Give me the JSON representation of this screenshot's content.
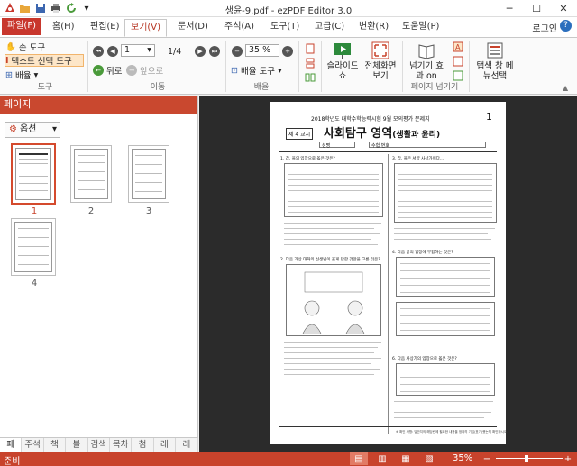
{
  "window": {
    "title": "생윤-9.pdf - ezPDF Editor 3.0"
  },
  "menu": {
    "tabs": [
      "파일(F)",
      "홈(H)",
      "편집(E)",
      "보기(V)",
      "문서(D)",
      "주석(A)",
      "도구(T)",
      "고급(C)",
      "변환(R)",
      "도움말(P)"
    ],
    "login": "로그인"
  },
  "ribbon": {
    "tools": {
      "hand": "손 도구",
      "text_select": "텍스트 선택 도구",
      "zoom": "배율",
      "label": "도구"
    },
    "move": {
      "page": "1",
      "total": "1/4",
      "back": "뒤로",
      "forward": "앞으로",
      "label": "이동"
    },
    "zoom": {
      "value": "35 %",
      "dropdown": "배율 도구",
      "label": "배율"
    },
    "slideshow": "슬라이드쇼",
    "fullscreen": "전체화면 보기",
    "page_view": {
      "effect": "넘기기 효과 on",
      "label": "페이지 넘기기"
    },
    "tab_menu": "탭색 창 메뉴선택"
  },
  "left_panel": {
    "title": "페이지",
    "options": "옵션",
    "thumbs": [
      "1",
      "2",
      "3",
      "4"
    ],
    "bottom_tabs": [
      "페",
      "주석",
      "책",
      "블",
      "검색",
      "목차",
      "첨",
      "레",
      "레"
    ]
  },
  "document": {
    "header": "2018학년도 대학수학능력시험 9월 모의평가 문제지",
    "page_num": "1",
    "period": "제 4 교시",
    "subject": "사회탐구 영역",
    "subject_sub": "(생활과 윤리)",
    "name_label": "성명",
    "exam_no_label": "수험 번호",
    "q1": "1. 갑, 을의 입장으로 옳은 것은?",
    "q2": "2. 다음 가상 대화의 선생님이 옳게 답한 것만을 고른 것은?",
    "q3": "3. 갑, 을은 서양 사상가이다...",
    "q4": "4. 다음 글의 입장에 부합하는 것은?",
    "q5": "5. 표 의 (가)에 들어갈 내용으로 옳은 것은?",
    "q6": "6. 다음 사상가의 입장으로 옳은 것은?",
    "footer": "※ 확인 사항: 답안지의 해당란에 필요한 내용을 정확히 기입(표기)했는지 확인하시오."
  },
  "status": {
    "left": "준비",
    "zoom": "35%"
  },
  "colors": {
    "accent": "#c8432c",
    "ribbon": "#fafafa",
    "doc_bg": "#2b2b2b"
  }
}
